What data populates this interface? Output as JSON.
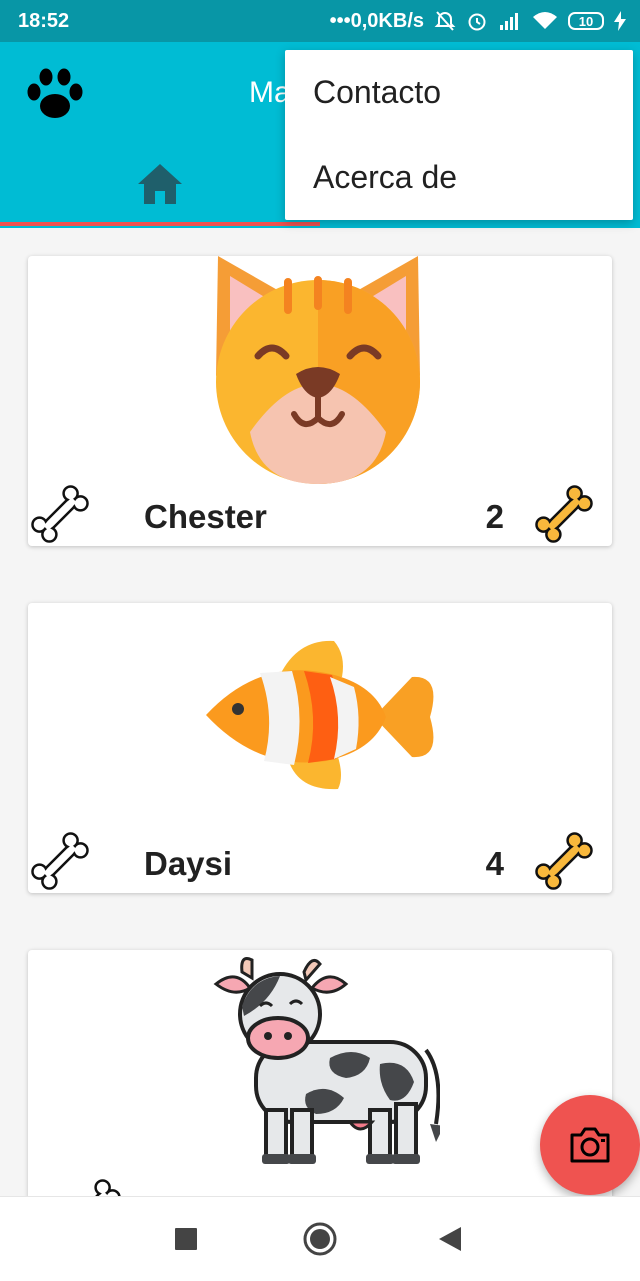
{
  "status_bar": {
    "time": "18:52",
    "network_speed": "•••0,0KB/s",
    "battery_level": "10"
  },
  "app_bar": {
    "title": "Ma",
    "icons": [
      "paw-icon",
      "home-icon"
    ],
    "color": "#00bcd4"
  },
  "overflow_menu": {
    "items": [
      {
        "label": "Contacto"
      },
      {
        "label": "Acerca de"
      }
    ]
  },
  "pets": [
    {
      "name": "Chester",
      "rating": "2",
      "image": "cat-image"
    },
    {
      "name": "Daysi",
      "rating": "4",
      "image": "fish-image"
    },
    {
      "name": "",
      "rating": "",
      "image": "cow-image"
    }
  ],
  "fab": {
    "icon": "camera-icon",
    "color": "#ef5350"
  },
  "nav_bar": {
    "icons": [
      "recents-icon",
      "home-circle-icon",
      "back-icon"
    ]
  }
}
